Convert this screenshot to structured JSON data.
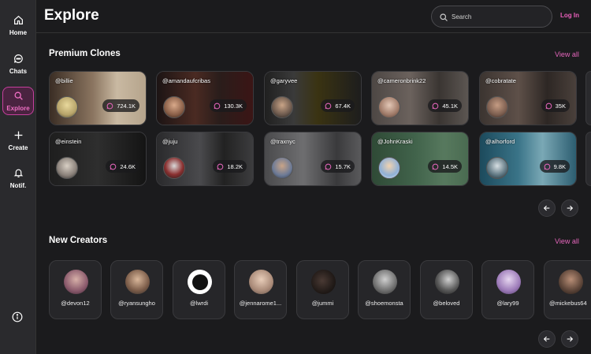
{
  "sidebar": {
    "items": [
      {
        "label": "Home",
        "icon": "home-icon"
      },
      {
        "label": "Chats",
        "icon": "chat-icon"
      },
      {
        "label": "Explore",
        "icon": "search-icon"
      },
      {
        "label": "Create",
        "icon": "plus-icon"
      },
      {
        "label": "Notif.",
        "icon": "bell-icon"
      }
    ],
    "info_icon": "info-icon"
  },
  "header": {
    "title": "Explore",
    "search_placeholder": "Search",
    "login_label": "Log In"
  },
  "premium": {
    "title": "Premium Clones",
    "view_all": "View all",
    "cards": [
      {
        "handle": "@billie",
        "count": "724.1K"
      },
      {
        "handle": "@amandaufcribas",
        "count": "130.3K"
      },
      {
        "handle": "@garyvee",
        "count": "67.4K"
      },
      {
        "handle": "@cameronbrink22",
        "count": "45.1K"
      },
      {
        "handle": "@cobratate",
        "count": "35K"
      },
      {
        "handle": "@einstein",
        "count": "24.6K"
      },
      {
        "handle": "@juju",
        "count": "18.2K"
      },
      {
        "handle": "@traxnyc",
        "count": "15.7K"
      },
      {
        "handle": "@JohnKraski",
        "count": "14.5K"
      },
      {
        "handle": "@alhorford",
        "count": "9.8K"
      }
    ]
  },
  "creators": {
    "title": "New Creators",
    "view_all": "View all",
    "items": [
      {
        "name": "@devon12"
      },
      {
        "name": "@ryansungho"
      },
      {
        "name": "@lwrdi"
      },
      {
        "name": "@jennarome1..."
      },
      {
        "name": "@jummi"
      },
      {
        "name": "@shoemonsta"
      },
      {
        "name": "@beloved"
      },
      {
        "name": "@lary99"
      },
      {
        "name": "@mickebus64"
      }
    ]
  },
  "colors": {
    "accent": "#e465bb",
    "background": "#1b1b1d",
    "sidebar": "#2a2a2d"
  }
}
